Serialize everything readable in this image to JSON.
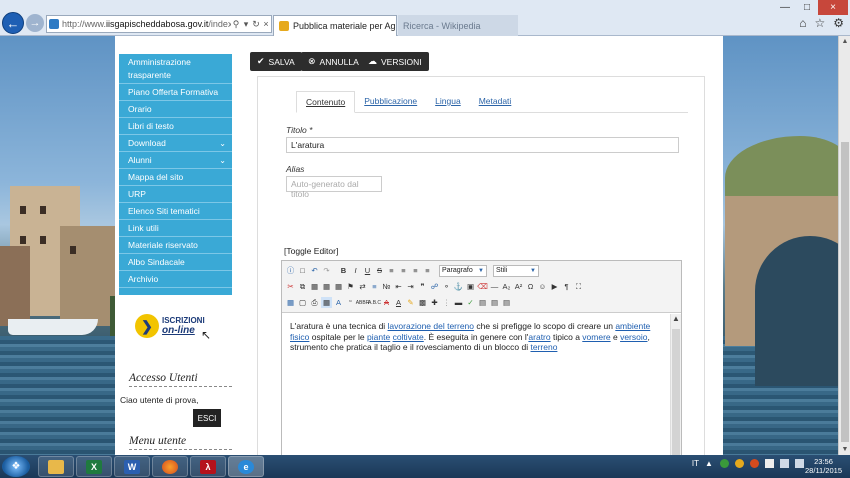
{
  "browser": {
    "url_prefix": "http://www.",
    "url_domain": "iisgapischeddabosa.gov.it",
    "url_path": "/index.php?o",
    "active_tab_title": "Pubblica materiale per Agra...",
    "inactive_tab_title": "Ricerca - Wikipedia"
  },
  "toolbar_buttons": {
    "save": "SALVA",
    "cancel": "ANNULLA",
    "versions": "VERSIONI"
  },
  "sidebar": {
    "items": [
      {
        "label": "Amministrazione trasparente"
      },
      {
        "label": "Piano Offerta Formativa"
      },
      {
        "label": "Orario"
      },
      {
        "label": "Libri di testo"
      },
      {
        "label": "Download"
      },
      {
        "label": "Alunni"
      },
      {
        "label": "Mappa del sito"
      },
      {
        "label": "URP"
      },
      {
        "label": "Elenco Siti tematici"
      },
      {
        "label": "Link utili"
      },
      {
        "label": "Materiale riservato"
      },
      {
        "label": "Albo Sindacale"
      },
      {
        "label": "Archivio"
      }
    ],
    "iscrizioni_line1": "ISCRIZIONI",
    "iscrizioni_line2": "on-line",
    "access_heading": "Accesso Utenti",
    "greeting": "Ciao utente di prova,",
    "logout": "ESCI",
    "menu_heading": "Menu utente"
  },
  "editor_tabs": [
    "Contenuto",
    "Pubblicazione",
    "Lingua",
    "Metadati"
  ],
  "form": {
    "title_label": "Titolo *",
    "title_value": "L'aratura",
    "alias_label": "Alias",
    "alias_placeholder": "Auto-generato dal titolo",
    "toggle_editor": "[Toggle Editor]",
    "format_select": "Paragrafo",
    "style_select": "Stili"
  },
  "content": {
    "p1": "L'aratura è una tecnica di ",
    "l1": "lavorazione del terreno",
    "p2": " che si prefigge lo scopo di creare un ",
    "l2": "ambiente fisico",
    "p3": " ospitale per le ",
    "l3": "piante",
    "p4": " ",
    "l4": "coltivate",
    "p5": ". È eseguita in genere con l'",
    "l5": "aratro",
    "p6": " tipico a ",
    "l6": "vomere",
    "p7": " e ",
    "l7": "versoio",
    "p8": ", strumento che pratica il taglio e il rovesciamento di un blocco di ",
    "l8": "terreno"
  },
  "taskbar": {
    "language": "IT",
    "time": "23:56",
    "date": "28/11/2015"
  }
}
